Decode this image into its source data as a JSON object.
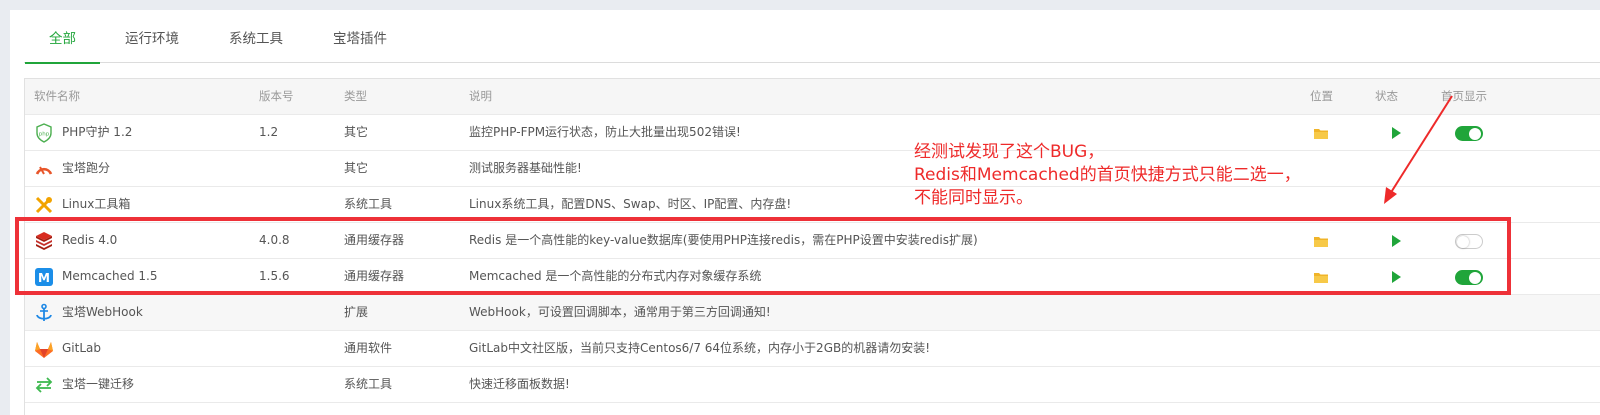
{
  "tabs": [
    {
      "label": "全部",
      "active": true
    },
    {
      "label": "运行环境",
      "active": false
    },
    {
      "label": "系统工具",
      "active": false
    },
    {
      "label": "宝塔插件",
      "active": false
    }
  ],
  "table": {
    "headers": {
      "name": "软件名称",
      "version": "版本号",
      "type": "类型",
      "desc": "说明",
      "location": "位置",
      "status": "状态",
      "homepage": "首页显示"
    },
    "rows": [
      {
        "icon": "php-shield-icon",
        "name": "PHP守护 1.2",
        "version": "1.2",
        "type": "其它",
        "desc": "监控PHP-FPM运行状态，防止大批量出现502错误!",
        "has_actions": true,
        "homepage_on": true
      },
      {
        "icon": "gauge-icon",
        "name": "宝塔跑分",
        "version": "",
        "type": "其它",
        "desc": "测试服务器基础性能!",
        "has_actions": false
      },
      {
        "icon": "tools-icon",
        "name": "Linux工具箱",
        "version": "",
        "type": "系统工具",
        "desc": "Linux系统工具，配置DNS、Swap、时区、IP配置、内存盘!",
        "has_actions": false
      },
      {
        "icon": "redis-icon",
        "name": "Redis 4.0",
        "version": "4.0.8",
        "type": "通用缓存器",
        "desc": "Redis 是一个高性能的key-value数据库(要使用PHP连接redis，需在PHP设置中安装redis扩展)",
        "has_actions": true,
        "homepage_on": false
      },
      {
        "icon": "memcached-icon",
        "name": "Memcached 1.5",
        "version": "1.5.6",
        "type": "通用缓存器",
        "desc": "Memcached 是一个高性能的分布式内存对象缓存系统",
        "has_actions": true,
        "homepage_on": true
      },
      {
        "icon": "anchor-icon",
        "name": "宝塔WebHook",
        "version": "",
        "type": "扩展",
        "desc": "WebHook，可设置回调脚本，通常用于第三方回调通知!",
        "has_actions": false
      },
      {
        "icon": "gitlab-icon",
        "name": "GitLab",
        "version": "",
        "type": "通用软件",
        "desc": "GitLab中文社区版，当前只支持Centos6/7 64位系统，内存小于2GB的机器请勿安装!",
        "has_actions": false
      },
      {
        "icon": "migrate-icon",
        "name": "宝塔一键迁移",
        "version": "",
        "type": "系统工具",
        "desc": "快速迁移面板数据!",
        "has_actions": false
      }
    ]
  },
  "annotation": {
    "line1": "经测试发现了这个BUG，",
    "line2": "Redis和Memcached的首页快捷方式只能二选一，",
    "line3": "不能同时显示。"
  },
  "colors": {
    "accent": "#20a53a",
    "annotation": "#ee2a2a",
    "folder": "#f0b429"
  }
}
